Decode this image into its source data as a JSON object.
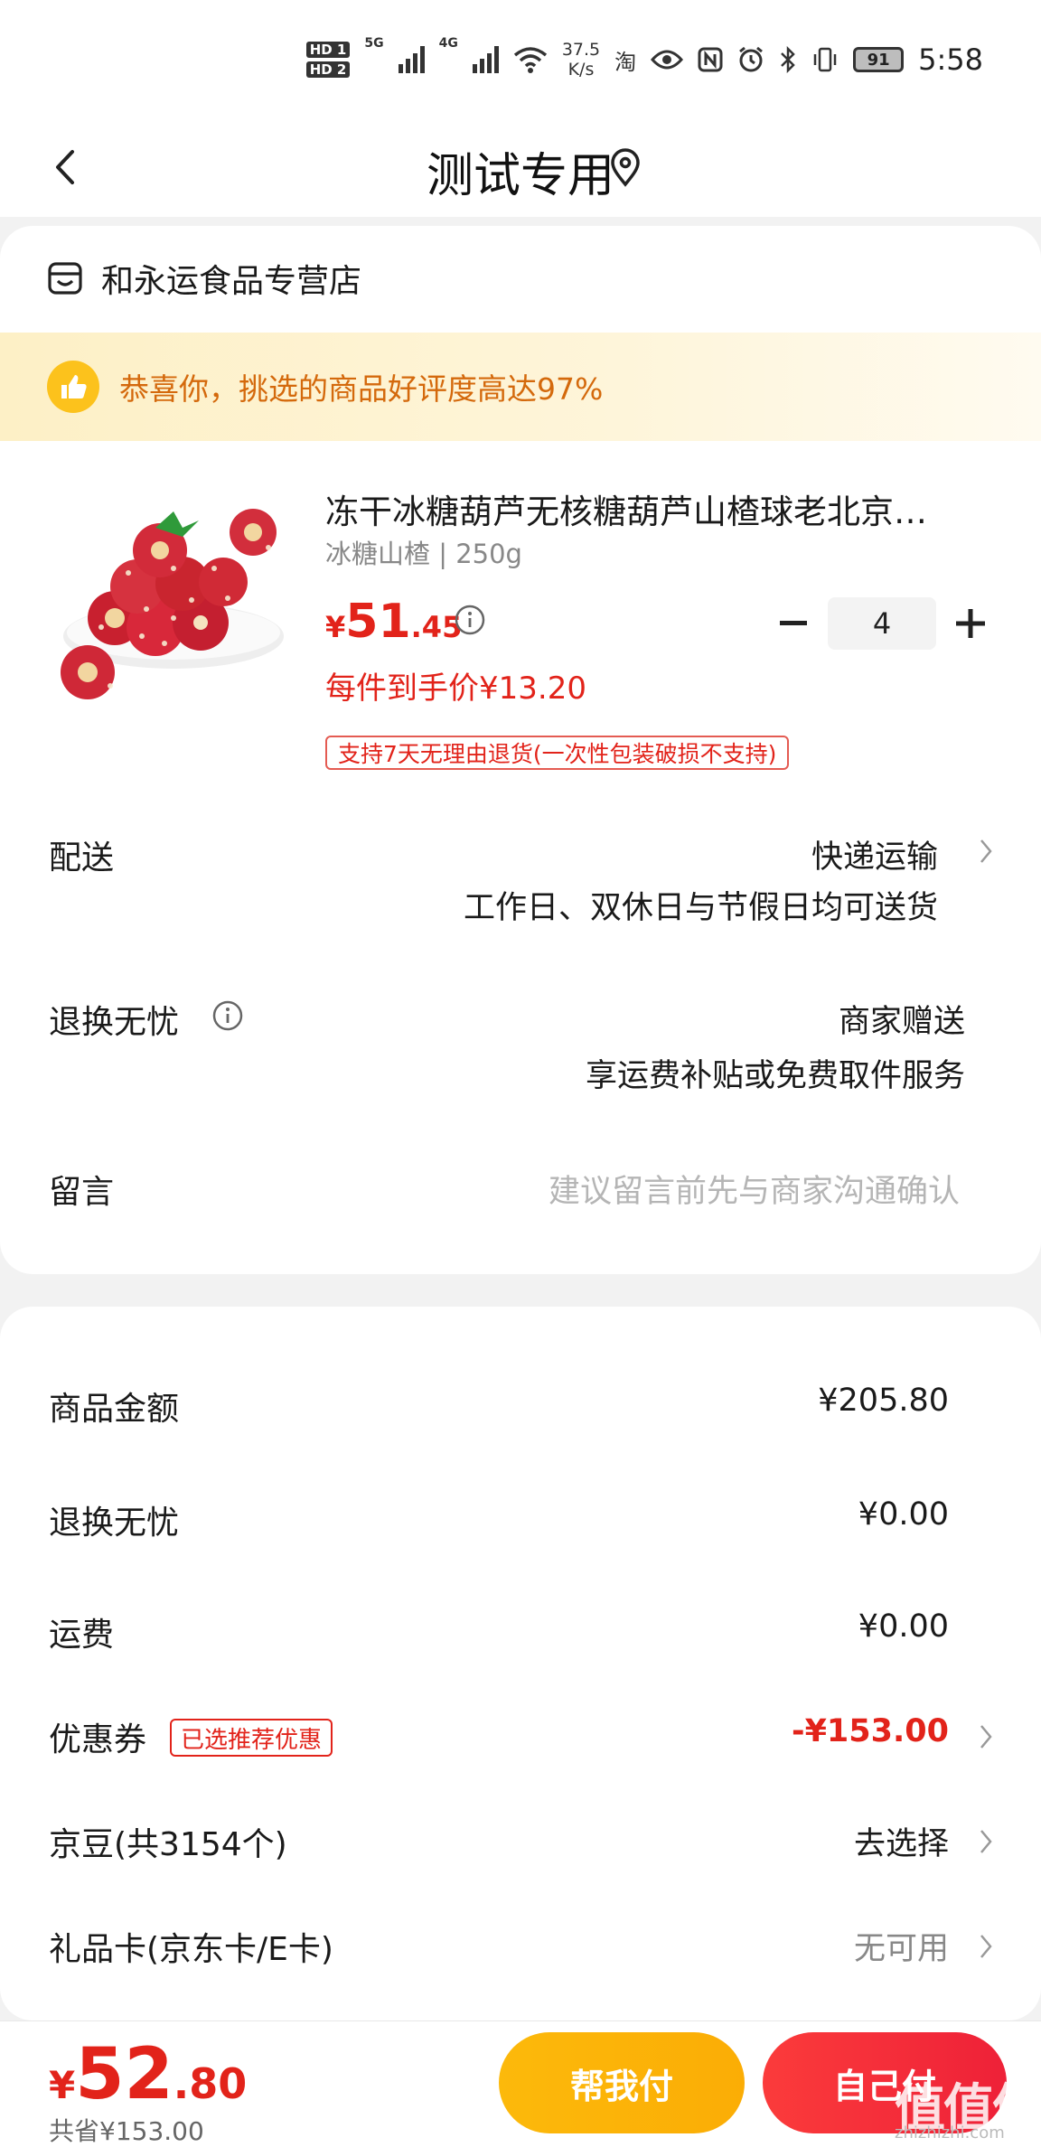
{
  "status_bar": {
    "hd1": "HD 1",
    "hd2": "HD 2",
    "net1": "5G",
    "net2": "4G",
    "speed_value": "37.5",
    "speed_unit": "K/s",
    "taobao_glyph": "淘",
    "battery": "91",
    "time": "5:58",
    "icons": [
      "wifi-icon",
      "eye-icon",
      "nfc-icon",
      "alarm-icon",
      "bluetooth-icon",
      "vibrate-icon"
    ]
  },
  "nav": {
    "title": "测试专用"
  },
  "store": {
    "name": "和永运食品专营店"
  },
  "praise": {
    "text": "恭喜你，挑选的商品好评度高达97%"
  },
  "product": {
    "title": "冻干冰糖葫芦无核糖葫芦山楂球老北京…",
    "spec": "冰糖山楂 | 250g",
    "price_symbol": "¥",
    "price_int": "51",
    "price_dec": ".45",
    "quantity": "4",
    "unit_price": "每件到手价¥13.20",
    "return_badge": "支持7天无理由退货(一次性包装破损不支持)"
  },
  "delivery": {
    "label": "配送",
    "method": "快递运输",
    "detail": "工作日、双休日与节假日均可送货"
  },
  "return_service": {
    "label": "退换无忧",
    "value": "商家赠送",
    "detail": "享运费补贴或免费取件服务"
  },
  "memo": {
    "label": "留言",
    "placeholder": "建议留言前先与商家沟通确认"
  },
  "summary": {
    "goods_label": "商品金额",
    "goods_value": "¥205.80",
    "return_label": "退换无忧",
    "return_value": "¥0.00",
    "shipping_label": "运费",
    "shipping_value": "¥0.00",
    "coupon_label": "优惠券",
    "coupon_tag": "已选推荐优惠",
    "coupon_value": "-¥153.00",
    "jingdou_label": "京豆(共3154个)",
    "jingdou_value": "去选择",
    "giftcard_label": "礼品卡(京东卡/E卡)",
    "giftcard_value": "无可用"
  },
  "bottom": {
    "total_symbol": "¥",
    "total_int": "52",
    "total_dec": ".80",
    "saved": "共省¥153.00",
    "help_pay": "帮我付",
    "self_pay": "自己付",
    "watermark": "值值值",
    "watermark_url": "zhizhizhi.com"
  },
  "colors": {
    "accent_red": "#e2231a",
    "praise_orange": "#d4690c",
    "help_yellow": "#fcb90b",
    "self_red": "#f22e3a"
  }
}
